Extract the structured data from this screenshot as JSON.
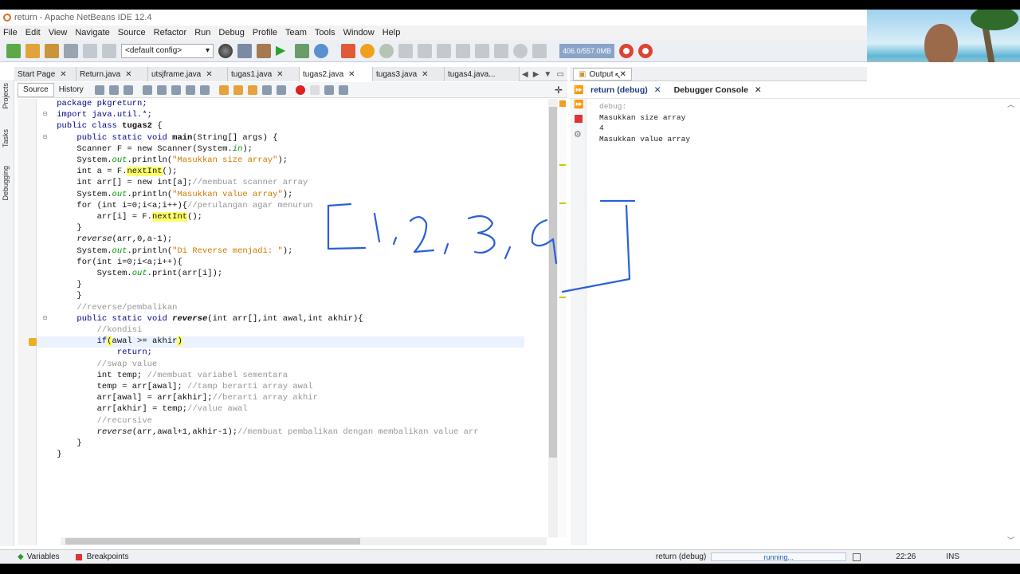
{
  "window": {
    "title": "return - Apache NetBeans IDE 12.4"
  },
  "menu": [
    "File",
    "Edit",
    "View",
    "Navigate",
    "Source",
    "Refactor",
    "Run",
    "Debug",
    "Profile",
    "Team",
    "Tools",
    "Window",
    "Help"
  ],
  "toolbar": {
    "config": "<default config>",
    "memory": "406.0/557.0MB"
  },
  "editor_tabs": [
    {
      "label": "Start Page",
      "active": false
    },
    {
      "label": "Return.java",
      "active": false
    },
    {
      "label": "utsjframe.java",
      "active": false
    },
    {
      "label": "tugas1.java",
      "active": false
    },
    {
      "label": "tugas2.java",
      "active": true
    },
    {
      "label": "tugas3.java",
      "active": false
    },
    {
      "label": "tugas4.java...",
      "active": false
    }
  ],
  "side_panels": [
    "Projects",
    "Tasks",
    "Debugging"
  ],
  "source_tabs": {
    "source": "Source",
    "history": "History"
  },
  "code": {
    "l1": "package pkgreturn;",
    "l2": "import java.util.*;",
    "l3a": "public class ",
    "l3b": "tugas2",
    "l3c": " {",
    "l4a": "    public static void ",
    "l4b": "main",
    "l4c": "(String[] args) {",
    "l5a": "    Scanner F = new Scanner(System.",
    "l5b": "in",
    "l5c": ");",
    "l6a": "    System.",
    "l6b": "out",
    "l6c": ".println(",
    "l6d": "\"Masukkan size array\"",
    "l6e": ");",
    "l7a": "    int a = F.",
    "l7b": "nextInt",
    "l7c": "();",
    "l8a": "    int arr[] = new int[a];",
    "l8b": "//membuat scanner array",
    "l9a": "    System.",
    "l9b": "out",
    "l9c": ".println(",
    "l9d": "\"Masukkan value array\"",
    "l9e": ");",
    "l10a": "    for (int i=0;i<a;i++){",
    "l10b": "//perulangan agar menurun",
    "l11a": "        arr[i] = F.",
    "l11b": "nextInt",
    "l11c": "();",
    "l12": "    }",
    "l13a": "    ",
    "l13b": "reverse",
    "l13c": "(arr,0,a-1);",
    "l14a": "    System.",
    "l14b": "out",
    "l14c": ".println(",
    "l14d": "\"Di Reverse menjadi: \"",
    "l14e": ");",
    "l15": "    for(int i=0;i<a;i++){",
    "l16a": "        System.",
    "l16b": "out",
    "l16c": ".print(arr[i]);",
    "l17": "    }",
    "l18": "    }",
    "l19": "    //reverse/pembalikan",
    "l20a": "    public static void ",
    "l20b": "reverse",
    "l20c": "(int arr[],int awal,int akhir){",
    "l21": "        //kondisi",
    "l22a": "        if",
    "l22b": "(",
    "l22c": "awal >= akhir",
    "l22d": ")",
    "l23": "            return;",
    "l24": "        //swap value",
    "l25a": "        int temp; ",
    "l25b": "//membuat variabel sementara",
    "l26a": "        temp = arr[awal]; ",
    "l26b": "//tamp berarti array awal",
    "l27a": "        arr[awal] = arr[akhir];",
    "l27b": "//berarti array akhir",
    "l28a": "        arr[akhir] = temp;",
    "l28b": "//value awal",
    "l29": "        //recursive",
    "l30a": "        ",
    "l30b": "reverse",
    "l30c": "(arr,awal+1,akhir-1);",
    "l30d": "//membuat pembalikan dengan membalikan value arr",
    "l31": "    }",
    "l32": "}",
    "l33": ""
  },
  "output": {
    "tab": "Output",
    "subtabs": [
      "return (debug)",
      "Debugger Console"
    ],
    "lines": [
      "debug:",
      "Masukkan size array",
      "4",
      "Masukkan value array"
    ]
  },
  "statusbar": {
    "variables": "Variables",
    "breakpoints": "Breakpoints",
    "task": "return (debug)",
    "progress": "running...",
    "position": "22:26",
    "mode": "INS"
  },
  "colors": {
    "keyword": "#00048c",
    "string": "#ce7b00",
    "comment": "#969696",
    "highlight": "#ffff6a",
    "ink": "#2a5fd8"
  }
}
